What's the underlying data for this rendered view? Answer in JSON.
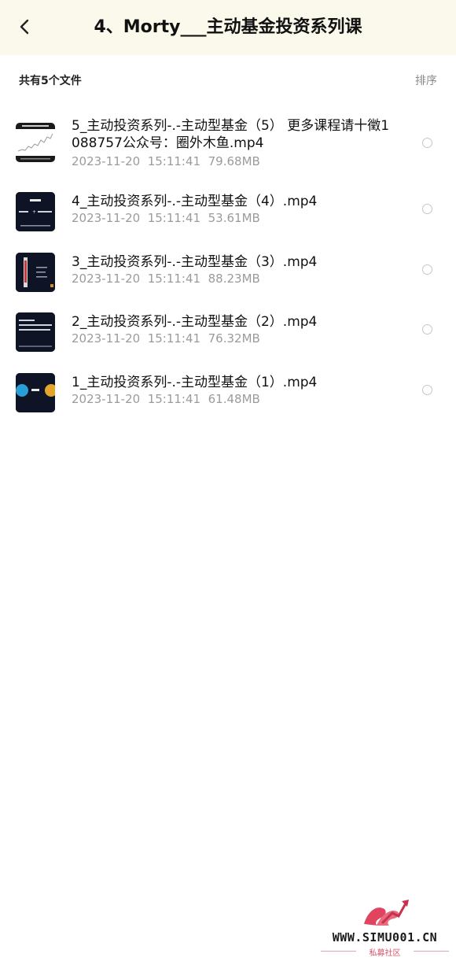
{
  "header": {
    "title": "4、Morty___主动基金投资系列课",
    "back_icon": "chevron-left-icon"
  },
  "toolbar": {
    "file_count": "共有5个文件",
    "sort_label": "排序"
  },
  "files": [
    {
      "name": "5_主动投资系列-.-主动型基金（5） 更多课程请十徵1088757公众号：圈外木鱼.mp4",
      "date": "2023-11-20  15:11:41",
      "size": "79.68MB",
      "thumb_icon": "video-thumbnail-chart"
    },
    {
      "name": "4_主动投资系列-.-主动型基金（4）.mp4",
      "date": "2023-11-20  15:11:41",
      "size": "53.61MB",
      "thumb_icon": "video-thumbnail-slide"
    },
    {
      "name": "3_主动投资系列-.-主动型基金（3）.mp4",
      "date": "2023-11-20  15:11:41",
      "size": "88.23MB",
      "thumb_icon": "video-thumbnail-bars"
    },
    {
      "name": "2_主动投资系列-.-主动型基金（2）.mp4",
      "date": "2023-11-20  15:11:41",
      "size": "76.32MB",
      "thumb_icon": "video-thumbnail-text"
    },
    {
      "name": "1_主动投资系列-.-主动型基金（1）.mp4",
      "date": "2023-11-20  15:11:41",
      "size": "61.48MB",
      "thumb_icon": "video-thumbnail-circles"
    }
  ],
  "watermark": {
    "url": "WWW.SIMU001.CN",
    "subtitle": "私募社区"
  },
  "colors": {
    "header_bg": "#fbf9ec",
    "meta_text": "#9b9b9b",
    "thumb_bg": "#0e1425",
    "watermark_accent": "#e0445e"
  }
}
